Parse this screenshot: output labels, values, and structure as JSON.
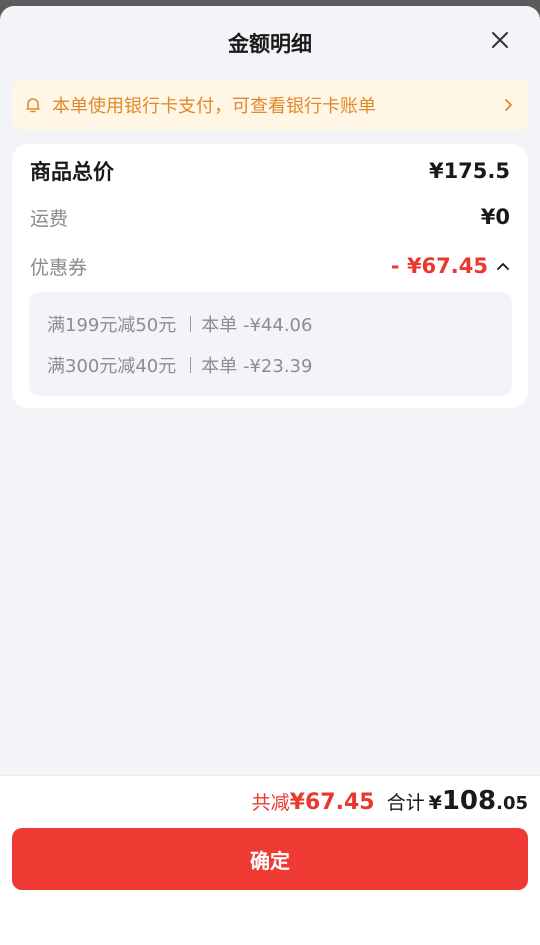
{
  "header": {
    "title": "金额明细",
    "close_icon": "close-icon"
  },
  "notice": {
    "text": "本单使用银行卡支付，可查看银行卡账单",
    "icon": "bell-icon",
    "arrow_icon": "chevron-right-icon"
  },
  "details": {
    "total_label": "商品总价",
    "total_value": "¥175.5",
    "shipping_label": "运费",
    "shipping_value": "¥0",
    "coupon_label": "优惠券",
    "coupon_value": "- ¥67.45",
    "coupon_caret_icon": "chevron-up-icon",
    "coupons": [
      {
        "rule": "满199元减50元",
        "amount": "本单 -¥44.06"
      },
      {
        "rule": "满300元减40元",
        "amount": "本单 -¥23.39"
      }
    ]
  },
  "footer": {
    "discount_label": "共减",
    "discount_value": "¥67.45",
    "total_label": "合计",
    "currency": "¥",
    "total_integer": "108",
    "total_decimal": ".05",
    "confirm_label": "确定"
  },
  "colors": {
    "accent_red": "#e8392f",
    "notice_bg": "#fff6e5",
    "notice_text": "#e08a2c",
    "page_bg": "#f3f4f8"
  }
}
